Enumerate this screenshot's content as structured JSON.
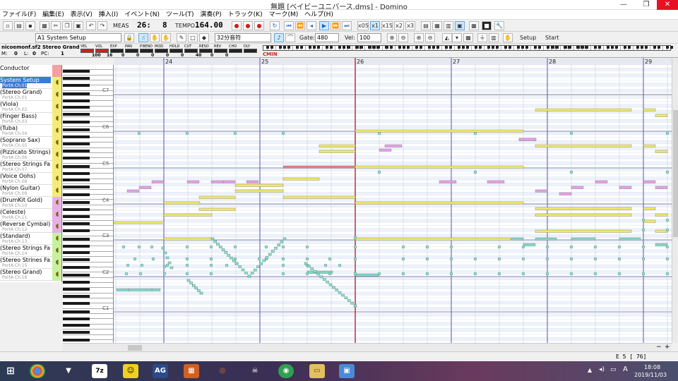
{
  "window": {
    "title": "無題 [ベイビーユニバース.dms] - Domino",
    "minimize": "—",
    "maximize": "❐",
    "close": "✕"
  },
  "menu": [
    "ファイル(F)",
    "編集(E)",
    "表示(V)",
    "挿入(I)",
    "イベント(N)",
    "ツール(T)",
    "演奏(P)",
    "トラック(K)",
    "マーク(M)",
    "ヘルプ(H)"
  ],
  "toolbar1": {
    "meas_label": "MEAS",
    "meas_value": "26:",
    "beat_value": "8",
    "tempo_label": "TEMPO",
    "tempo_value": "164.00",
    "speed_buttons": [
      "x05",
      "x1",
      "x15",
      "x2",
      "x3"
    ]
  },
  "toolbar2": {
    "track_select": "A1 System Setup",
    "quantize": "32分音符",
    "gate_label": "Gate:",
    "gate_value": "480",
    "vel_label": "Vel:",
    "vel_value": "100",
    "setup_label": "Setup",
    "start_label": "Start"
  },
  "ctlbar": {
    "sf_name": "nicoemonf.sf2 Stereo Grand",
    "m_label": "M:",
    "m_value": "0",
    "l_label": "L:",
    "l_value": "0",
    "pc_label": "PC:",
    "pc_value": "1",
    "ctl_labels": [
      "VEL",
      "VOL",
      "EXP",
      "PAN",
      "P.BEND",
      "MOD",
      "HOLD",
      "CUT",
      "RESO",
      "REV",
      "CHO",
      "DLY"
    ],
    "ctl_values": [
      "100",
      "16",
      "0",
      "0",
      "0",
      "0",
      "0",
      "40",
      "0",
      "0"
    ],
    "chord": "CMIN"
  },
  "tracks": [
    {
      "name": "Conductor",
      "port": ""
    },
    {
      "name": "System Setup",
      "port": "PortA  Ch.01"
    },
    {
      "name": "(Stereo Grand)",
      "port": "PortA  Ch.01"
    },
    {
      "name": "(Viola)",
      "port": "PortA  Ch.02"
    },
    {
      "name": "(Finger Bass)",
      "port": "PortA  Ch.03"
    },
    {
      "name": "(Tuba)",
      "port": "PortA  Ch.04"
    },
    {
      "name": "(Soprano Sax)",
      "port": "PortA  Ch.05"
    },
    {
      "name": "(Pizzicato Strings)",
      "port": "PortA  Ch.06"
    },
    {
      "name": "(Stereo Strings Fa...",
      "port": "PortA  Ch.07"
    },
    {
      "name": "(Voice Oohs)",
      "port": "PortA  Ch.08"
    },
    {
      "name": "(Nylon Guitar)",
      "port": "PortA  Ch.09"
    },
    {
      "name": "(DrumKit Gold)",
      "port": "PortA  Ch.10"
    },
    {
      "name": "(Celeste)",
      "port": "PortA  Ch.11"
    },
    {
      "name": "(Reverse Cymbal)",
      "port": "PortA  Ch.12"
    },
    {
      "name": "(Standard)",
      "port": "PortA  Ch.13"
    },
    {
      "name": "(Stereo Strings Fa...",
      "port": "PortA  Ch.14"
    },
    {
      "name": "(Stereo Strines Fa...",
      "port": "PortA  Ch.15"
    },
    {
      "name": "(Stereo Grand)",
      "port": "PortA  Ch.16"
    }
  ],
  "octave_labels": [
    "C7",
    "C6",
    "C5",
    "C4",
    "C3",
    "C2",
    "C1"
  ],
  "measures": [
    "24",
    "25",
    "26",
    "27",
    "28",
    "29"
  ],
  "status": {
    "position": "E 5 [ 76]"
  },
  "taskbar": {
    "icons": [
      "start",
      "chrome",
      "fox",
      "7z",
      "sprite",
      "ag",
      "box",
      "headphones",
      "skull",
      "disc",
      "folder",
      "app"
    ],
    "ag_label": "AG",
    "z7_label": "7z",
    "ime": "A",
    "time": "18:08",
    "date": "2019/11/03"
  },
  "colors": {
    "yellow_note": "#f0e86a",
    "pink_note": "#e6a0e6",
    "cyan_note": "#7fd8c8",
    "red_note": "#e08080",
    "measure_line": "#7070c0",
    "playhead": "#c03030",
    "track_icon": "#f4ec7a",
    "selected_track": "#3a7bd5"
  }
}
